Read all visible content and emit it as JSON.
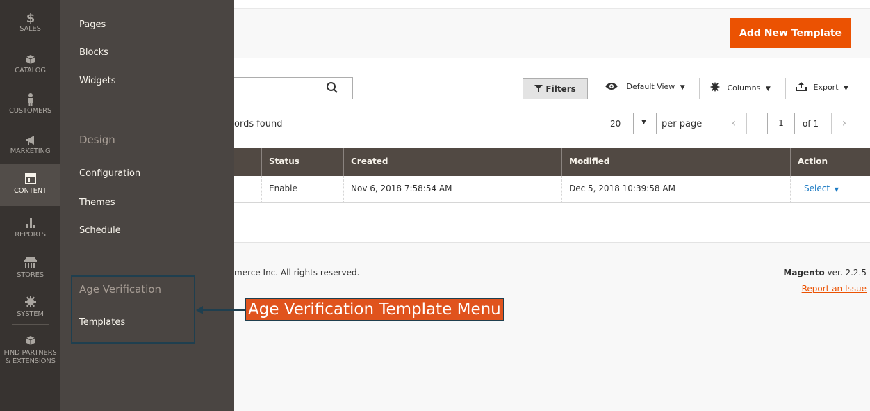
{
  "main_nav": [
    {
      "label": "SALES",
      "icon": "dollar-icon"
    },
    {
      "label": "CATALOG",
      "icon": "box-icon"
    },
    {
      "label": "CUSTOMERS",
      "icon": "person-icon"
    },
    {
      "label": "MARKETING",
      "icon": "megaphone-icon"
    },
    {
      "label": "CONTENT",
      "icon": "layout-icon",
      "active": true
    },
    {
      "label": "REPORTS",
      "icon": "bar-chart-icon"
    },
    {
      "label": "STORES",
      "icon": "store-icon"
    },
    {
      "label": "SYSTEM",
      "icon": "gear-icon"
    },
    {
      "label": "FIND PARTNERS",
      "label2": "& EXTENSIONS",
      "icon": "cube-icon"
    }
  ],
  "flyout": {
    "elements": [
      "Pages",
      "Blocks",
      "Widgets"
    ],
    "design_heading": "Design",
    "design": [
      "Configuration",
      "Themes",
      "Schedule"
    ],
    "age_heading": "Age Verification",
    "age_items": [
      "Templates"
    ]
  },
  "header": {
    "add_button": "Add New Template"
  },
  "toolbar": {
    "filters": "Filters",
    "default_view": "Default View",
    "columns": "Columns",
    "export": "Export",
    "records_found": "ords found",
    "per_page_value": "20",
    "per_page_label": "per page",
    "page_current": "1",
    "page_of": "of 1"
  },
  "grid": {
    "headers": [
      "Status",
      "Created",
      "Modified",
      "Action"
    ],
    "row": {
      "status": "Enable",
      "created": "Nov 6, 2018 7:58:54 AM",
      "modified": "Dec 5, 2018 10:39:58 AM",
      "action": "Select"
    }
  },
  "footer": {
    "copyright": "merce Inc. All rights reserved.",
    "version_brand": "Magento",
    "version_text": " ver. 2.2.5",
    "report_issue": "Report an Issue"
  },
  "annotation": {
    "label": "Age Verification Template Menu"
  },
  "colors": {
    "accent": "#eb5202",
    "nav_bg": "#373330",
    "flyout_bg": "#4a4542",
    "grid_head": "#514943",
    "link": "#1979c3",
    "annotation": "#e0531d"
  }
}
